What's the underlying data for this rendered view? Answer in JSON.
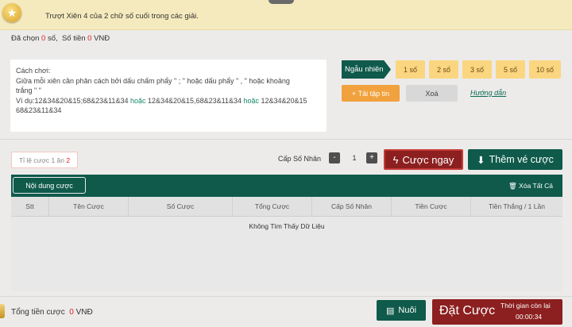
{
  "banner": {
    "text": "Trượt Xiên 4 của 2 chữ số cuối trong các giải.",
    "icon": "star-icon"
  },
  "summary": {
    "selected_label": "Đã chọn",
    "selected_count": "0",
    "selected_unit": "số,",
    "amount_label": "Số tiền",
    "amount_value": "0",
    "amount_unit": "VNĐ"
  },
  "howto": {
    "title": "Cách chơi:",
    "line1": "Giữa mỗi xiên cần phân cách bởi dấu chấm phẩy \" ; \" hoặc dấu phẩy \" , \" hoặc khoảng",
    "line2": "trắng \" \"",
    "ex_prefix": "Ví dụ:12&34&20&15;68&23&11&34",
    "or1": "hoặc",
    "ex2": "12&34&20&15,68&23&11&34",
    "or2": "hoặc",
    "ex3a": "12&34&20&15",
    "ex3b": "68&23&11&34"
  },
  "controls": {
    "random_label": "Ngẫu nhiên",
    "counts": [
      "1 số",
      "2 số",
      "3 số",
      "5 số",
      "10 số"
    ],
    "upload_label": "Tải tập tin",
    "clear_label": "Xoá",
    "guide_label": "Hướng dẫn"
  },
  "bet_bar": {
    "odds_prefix": "Tỉ lệ cược",
    "odds_left": "1",
    "odds_mid": "ăn",
    "odds_right": "2",
    "multiplier_label": "Cấp Số Nhân",
    "multiplier_value": "1",
    "minus": "-",
    "plus": "+",
    "bet_now_label": "Cược ngay",
    "add_ticket_label": "Thêm vé cược"
  },
  "table": {
    "content_btn": "Nội dung cược",
    "delete_all": "Xóa Tất Cả",
    "columns": [
      "Stt",
      "Tên Cược",
      "Số Cược",
      "Tổng Cược",
      "Cấp Số Nhân",
      "Tiền Cược",
      "Tiền Thắng / 1 Lần"
    ],
    "empty_text": "Không Tìm Thấy Dữ Liệu"
  },
  "footer": {
    "total_label": "Tổng tiền cược",
    "total_value": "0",
    "total_unit": "VNĐ",
    "savings_label": "Nuôi",
    "place_label": "Đặt Cược",
    "timer_label": "Thời gian còn lại",
    "timer_value": "00:00:34"
  },
  "colors": {
    "brand_green": "#0f5a4b",
    "brand_red": "#8c1f1f",
    "accent_yellow": "#fbd680",
    "accent_orange": "#f1a13d"
  }
}
